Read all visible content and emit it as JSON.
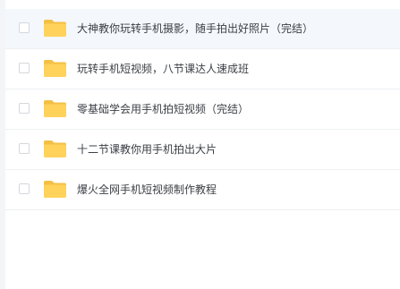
{
  "file_list": {
    "items": [
      {
        "name": "大神教你玩转手机摄影，随手拍出好照片（完结）",
        "icon": "folder-icon",
        "selected": true
      },
      {
        "name": "玩转手机短视频，八节课达人速成班",
        "icon": "folder-icon",
        "selected": false
      },
      {
        "name": "零基础学会用手机拍短视频（完结）",
        "icon": "folder-icon",
        "selected": false
      },
      {
        "name": "十二节课教你用手机拍出大片",
        "icon": "folder-icon",
        "selected": false
      },
      {
        "name": "爆火全网手机短视频制作教程",
        "icon": "folder-icon",
        "selected": false
      }
    ]
  },
  "colors": {
    "folder_body": "#ffd25c",
    "folder_tab": "#f4c043",
    "selected_row": "#f4f8fd",
    "text": "#3b3f45"
  }
}
